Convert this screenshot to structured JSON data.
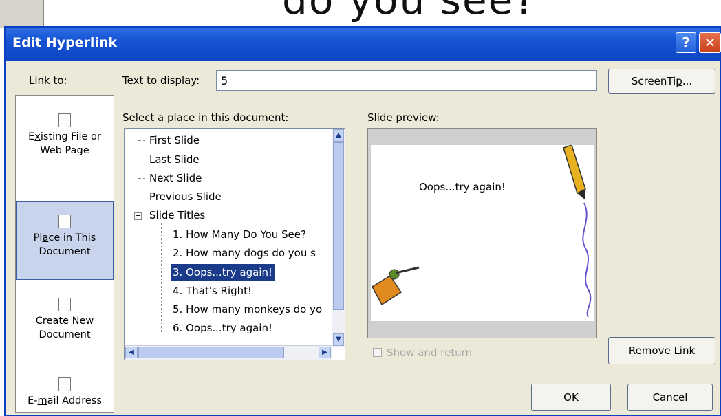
{
  "background": {
    "slide_text": "do you see?"
  },
  "dialog": {
    "title": "Edit Hyperlink",
    "help_label": "?",
    "close_label": "✕"
  },
  "link_to": {
    "label": "Link to:",
    "items": [
      {
        "label_a": "E",
        "label_u": "x",
        "label_b": "isting File or",
        "label_2": "Web Page"
      },
      {
        "label_a": "Pl",
        "label_u": "a",
        "label_b": "ce in This",
        "label_2": "Document"
      },
      {
        "label_a": "Create ",
        "label_u": "N",
        "label_b": "ew",
        "label_2": "Document"
      },
      {
        "label_a": "E-",
        "label_u": "m",
        "label_b": "ail Address"
      }
    ]
  },
  "text_to_display": {
    "label_u": "T",
    "label_rest": "ext to display:",
    "value": "5"
  },
  "screentip": {
    "a": "ScreenTi",
    "u": "p",
    "b": "..."
  },
  "tree": {
    "label_a": "Select a pla",
    "label_u": "c",
    "label_b": "e in this document:",
    "items": [
      "First Slide",
      "Last Slide",
      "Next Slide",
      "Previous Slide",
      "Slide Titles",
      "1. How Many Do You See?",
      "2. How many dogs  do you s",
      "3. Oops...try again!",
      "4. That's Right!",
      "5. How many monkeys do yo",
      "6. Oops...try again!"
    ],
    "expander": "−"
  },
  "preview": {
    "label": "Slide preview:",
    "slide_text": "Oops...try again!"
  },
  "show_return": {
    "label": "Show and return"
  },
  "remove_link": {
    "u": "R",
    "b": "emove Link"
  },
  "ok": {
    "label": "OK"
  },
  "cancel": {
    "label": "Cancel"
  },
  "scroll": {
    "up": "▲",
    "down": "▼",
    "left": "◀",
    "right": "▶"
  }
}
